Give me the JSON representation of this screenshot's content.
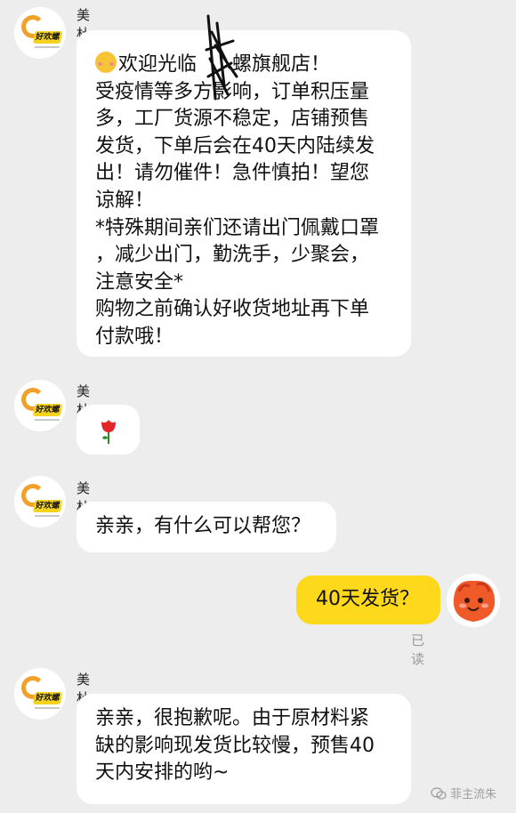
{
  "messages": [
    {
      "sender": "美杜莎",
      "lines": [
        "欢迎光临",
        "螺旗舰店！",
        "受疫情等多方",
        "影响，订单积压量",
        "多，工厂货源不稳定，店铺预售",
        "发货，下单后会在40天内陆续发",
        "出！请勿催件！急件慎拍！望您",
        "谅解！",
        "*特殊期间亲们还请出门佩戴口罩",
        "，减少出门，勤洗手，少聚会，",
        "注意安全*",
        "购物之前确认好收货地址再下单",
        "付款哦！"
      ]
    },
    {
      "sender": "美杜莎",
      "emoji": "rose"
    },
    {
      "sender": "美杜莎",
      "lines": [
        "亲亲，有什么可以帮您？"
      ]
    },
    {
      "sender": "me",
      "lines": [
        "40天发货？"
      ],
      "status": "已读"
    },
    {
      "sender": "美杜莎",
      "lines": [
        "亲亲，很抱歉呢。由于原材料紧",
        "缺的影响现发货比较慢，预售40",
        "天内安排的哟~"
      ]
    }
  ],
  "shop_avatar": {
    "badge_text": "好欢螺"
  },
  "watermark": "菲主流朱",
  "colors": {
    "background": "#ededed",
    "incoming_bubble": "#ffffff",
    "outgoing_bubble": "#fed81b",
    "read_status": "#9a9a9a"
  }
}
